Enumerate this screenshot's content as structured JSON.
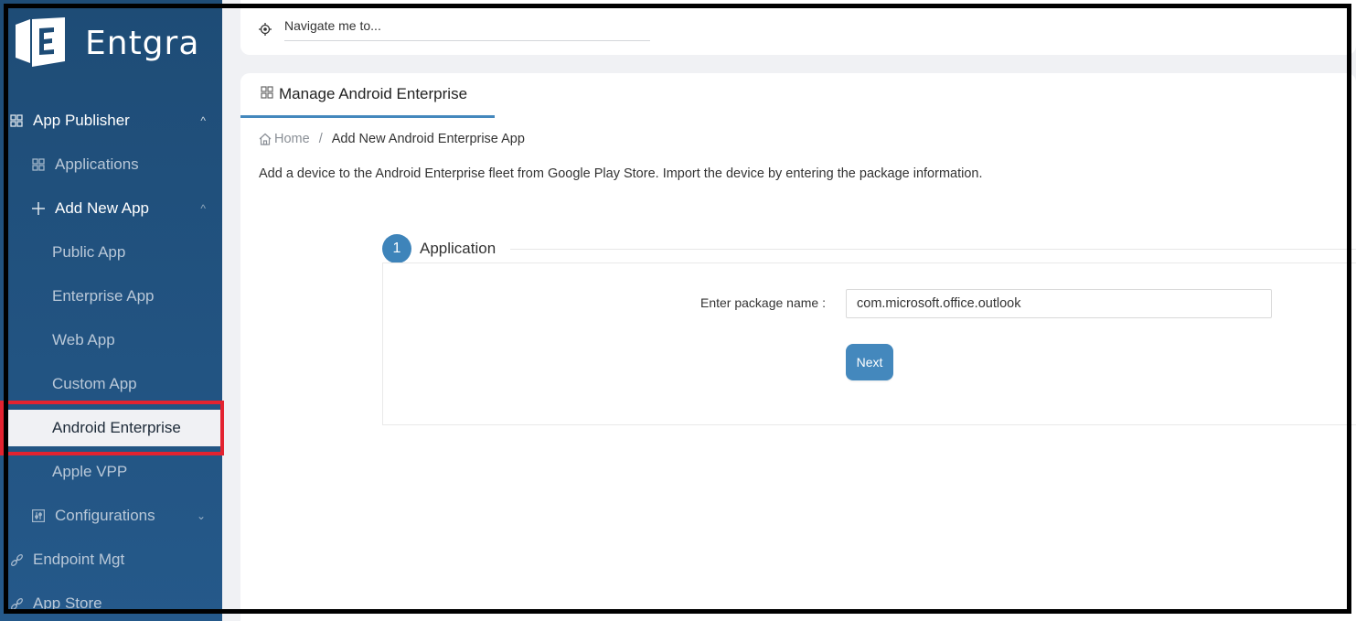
{
  "brand": {
    "name": "Entgra"
  },
  "sidebar": {
    "items": [
      {
        "label": "App Publisher",
        "icon": "grid-icon",
        "expanded": true
      },
      {
        "label": "Applications",
        "icon": "grid-icon"
      },
      {
        "label": "Add New App",
        "icon": "plus-icon",
        "expanded": true
      },
      {
        "label": "Public App"
      },
      {
        "label": "Enterprise App"
      },
      {
        "label": "Web App"
      },
      {
        "label": "Custom App"
      },
      {
        "label": "Android Enterprise",
        "selected": true
      },
      {
        "label": "Apple VPP"
      },
      {
        "label": "Configurations",
        "icon": "sliders-icon",
        "expanded": false
      },
      {
        "label": "Endpoint Mgt",
        "icon": "link-icon"
      },
      {
        "label": "App Store",
        "icon": "link-icon"
      }
    ]
  },
  "topbar": {
    "navigate_placeholder": "Navigate me to..."
  },
  "page": {
    "tab_label": "Manage Android Enterprise",
    "breadcrumb": {
      "home": "Home",
      "separator": "/",
      "current": "Add New Android Enterprise App"
    },
    "description": "Add a device to the Android Enterprise fleet from Google Play Store. Import the device by entering the package information.",
    "step": {
      "number": "1",
      "title": "Application"
    },
    "form": {
      "package_label": "Enter package name :",
      "package_value": "com.microsoft.office.outlook",
      "next_label": "Next"
    }
  },
  "colors": {
    "sidebar": "#1e4c76",
    "accent": "#4488bd",
    "highlight": "#e32330"
  }
}
